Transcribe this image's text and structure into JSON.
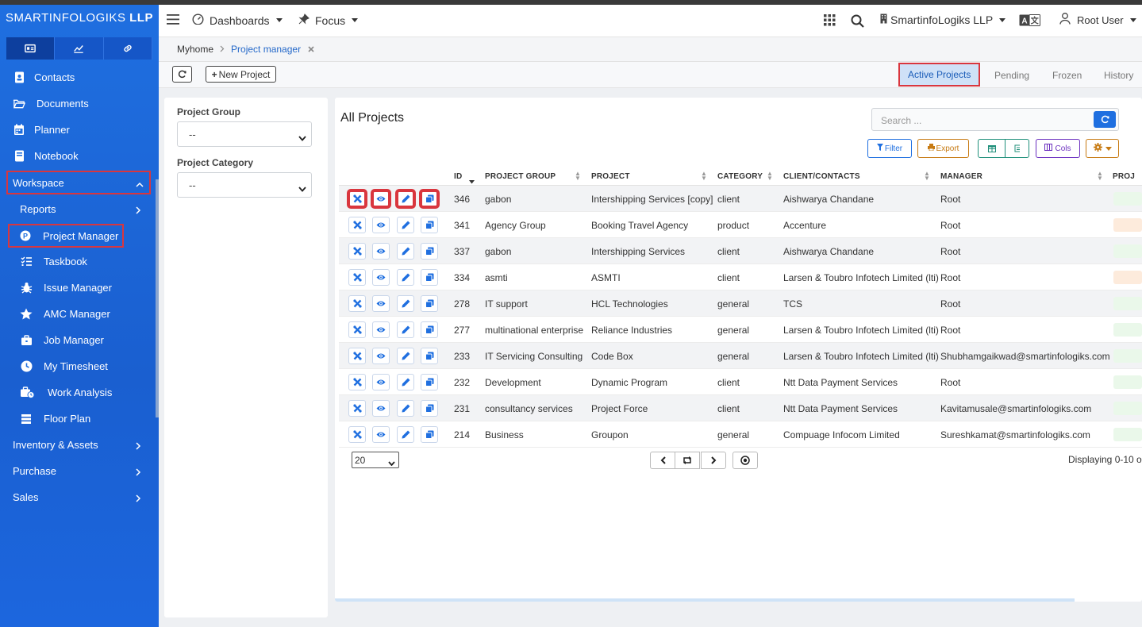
{
  "sidebar": {
    "brand_light": "SMARTINFOLOGIKS",
    "brand_bold": "LLP",
    "items": [
      {
        "label": "Contacts"
      },
      {
        "label": "Documents"
      },
      {
        "label": "Planner"
      },
      {
        "label": "Notebook"
      },
      {
        "label": "Workspace"
      },
      {
        "label": "Reports"
      },
      {
        "label": "Project Manager"
      },
      {
        "label": "Taskbook"
      },
      {
        "label": "Issue Manager"
      },
      {
        "label": "AMC Manager"
      },
      {
        "label": "Job Manager"
      },
      {
        "label": "My Timesheet"
      },
      {
        "label": "Work Analysis"
      },
      {
        "label": "Floor Plan"
      },
      {
        "label": "Inventory & Assets"
      },
      {
        "label": "Purchase"
      },
      {
        "label": "Sales"
      }
    ]
  },
  "topbar": {
    "dashboards": "Dashboards",
    "focus": "Focus",
    "company": "SmartinfoLogiks LLP",
    "user": "Root User"
  },
  "breadcrumb": {
    "home": "Myhome",
    "current": "Project manager"
  },
  "toolbar": {
    "new_project": "New Project",
    "tabs": [
      "Active Projects",
      "Pending",
      "Frozen",
      "History"
    ]
  },
  "filters": {
    "group_label": "Project Group",
    "group_value": "--",
    "category_label": "Project Category",
    "category_value": "--"
  },
  "main": {
    "title": "All Projects",
    "search_placeholder": "Search ...",
    "filter_btn": "Filter",
    "export_btn": "Export",
    "cols_btn": "Cols",
    "columns": [
      "ID",
      "PROJECT GROUP",
      "PROJECT",
      "CATEGORY",
      "CLIENT/CONTACTS",
      "MANAGER",
      "PROJ"
    ],
    "rows": [
      {
        "id": "346",
        "group": "gabon",
        "project": "Intershipping Services [copy]",
        "category": "client",
        "client": "Aishwarya Chandane",
        "manager": "Root",
        "status_color": "#eaf8ea"
      },
      {
        "id": "341",
        "group": "Agency Group",
        "project": "Booking Travel Agency",
        "category": "product",
        "client": "Accenture",
        "manager": "Root",
        "status_color": "#fdebdc"
      },
      {
        "id": "337",
        "group": "gabon",
        "project": "Intershipping Services",
        "category": "client",
        "client": "Aishwarya Chandane",
        "manager": "Root",
        "status_color": "#eaf8ea"
      },
      {
        "id": "334",
        "group": "asmti",
        "project": "ASMTI",
        "category": "client",
        "client": "Larsen & Toubro Infotech Limited (lti)",
        "manager": "Root",
        "status_color": "#fdebdc"
      },
      {
        "id": "278",
        "group": "IT support",
        "project": "HCL Technologies",
        "category": "general",
        "client": "TCS",
        "manager": "Root",
        "status_color": "#eaf8ea"
      },
      {
        "id": "277",
        "group": "multinational enterprise",
        "project": "Reliance Industries",
        "category": "general",
        "client": "Larsen & Toubro Infotech Limited (lti)",
        "manager": "Root",
        "status_color": "#eaf8ea"
      },
      {
        "id": "233",
        "group": "IT Servicing Consulting",
        "project": "Code Box",
        "category": "general",
        "client": "Larsen & Toubro Infotech Limited (lti)",
        "manager": "Shubhamgaikwad@smartinfologiks.com",
        "status_color": "#eaf8ea"
      },
      {
        "id": "232",
        "group": "Development",
        "project": "Dynamic Program",
        "category": "client",
        "client": "Ntt Data Payment Services",
        "manager": "Root",
        "status_color": "#eaf8ea"
      },
      {
        "id": "231",
        "group": "consultancy services",
        "project": "Project Force",
        "category": "client",
        "client": "Ntt Data Payment Services",
        "manager": "Kavitamusale@smartinfologiks.com",
        "status_color": "#eaf8ea"
      },
      {
        "id": "214",
        "group": "Business",
        "project": "Groupon",
        "category": "general",
        "client": "Compuage Infocom Limited",
        "manager": "Sureshkamat@smartinfologiks.com",
        "status_color": "#eaf8ea"
      }
    ],
    "page_size": "20",
    "displaying": "Displaying 0-10 o"
  },
  "colors": {
    "accent": "#1f6fe0",
    "highlight": "#d9363e",
    "export": "#c77a12",
    "cols": "#6b2fbf",
    "grid": "#1f8f7a"
  }
}
